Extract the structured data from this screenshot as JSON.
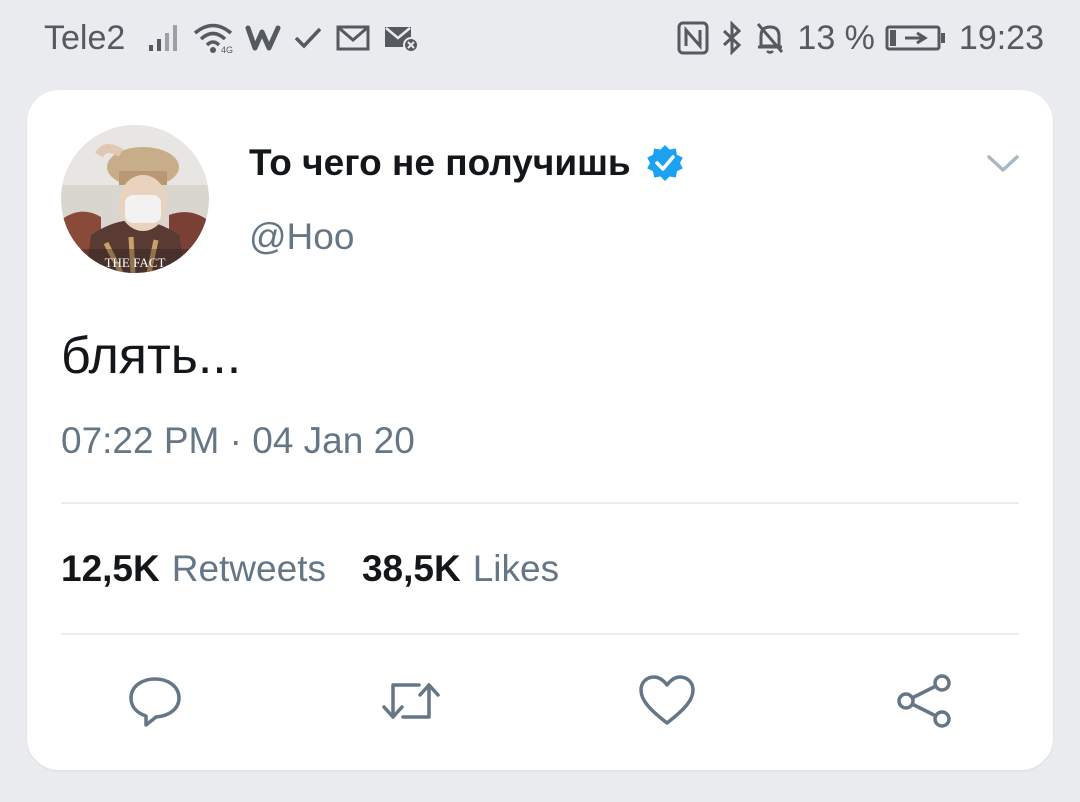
{
  "status_bar": {
    "carrier": "Tele2",
    "battery_percent": "13 %",
    "time": "19:23",
    "left_icons": [
      "signal-icon",
      "wifi-icon",
      "wattpad-icon",
      "check-icon",
      "gmail-icon",
      "mail-icon"
    ],
    "right_icons": [
      "nfc-icon",
      "bluetooth-icon",
      "notifications-off-icon",
      "battery-charging-icon"
    ]
  },
  "tweet": {
    "display_name": "То чего не получишь",
    "handle": "@Hoo",
    "verified": true,
    "text": "блять...",
    "timestamp": "07:22 PM · 04 Jan 20",
    "avatar_watermark": "THE FACT",
    "stats": {
      "retweets_count": "12,5K",
      "retweets_label": "Retweets",
      "likes_count": "38,5K",
      "likes_label": "Likes"
    },
    "actions": [
      "reply-icon",
      "retweet-icon",
      "like-icon",
      "share-icon"
    ]
  },
  "colors": {
    "background": "#e9ebee",
    "card": "#ffffff",
    "text_primary": "#14171a",
    "text_secondary": "#657786",
    "verified_blue": "#1da1f2",
    "divider": "#e6ecf0"
  }
}
